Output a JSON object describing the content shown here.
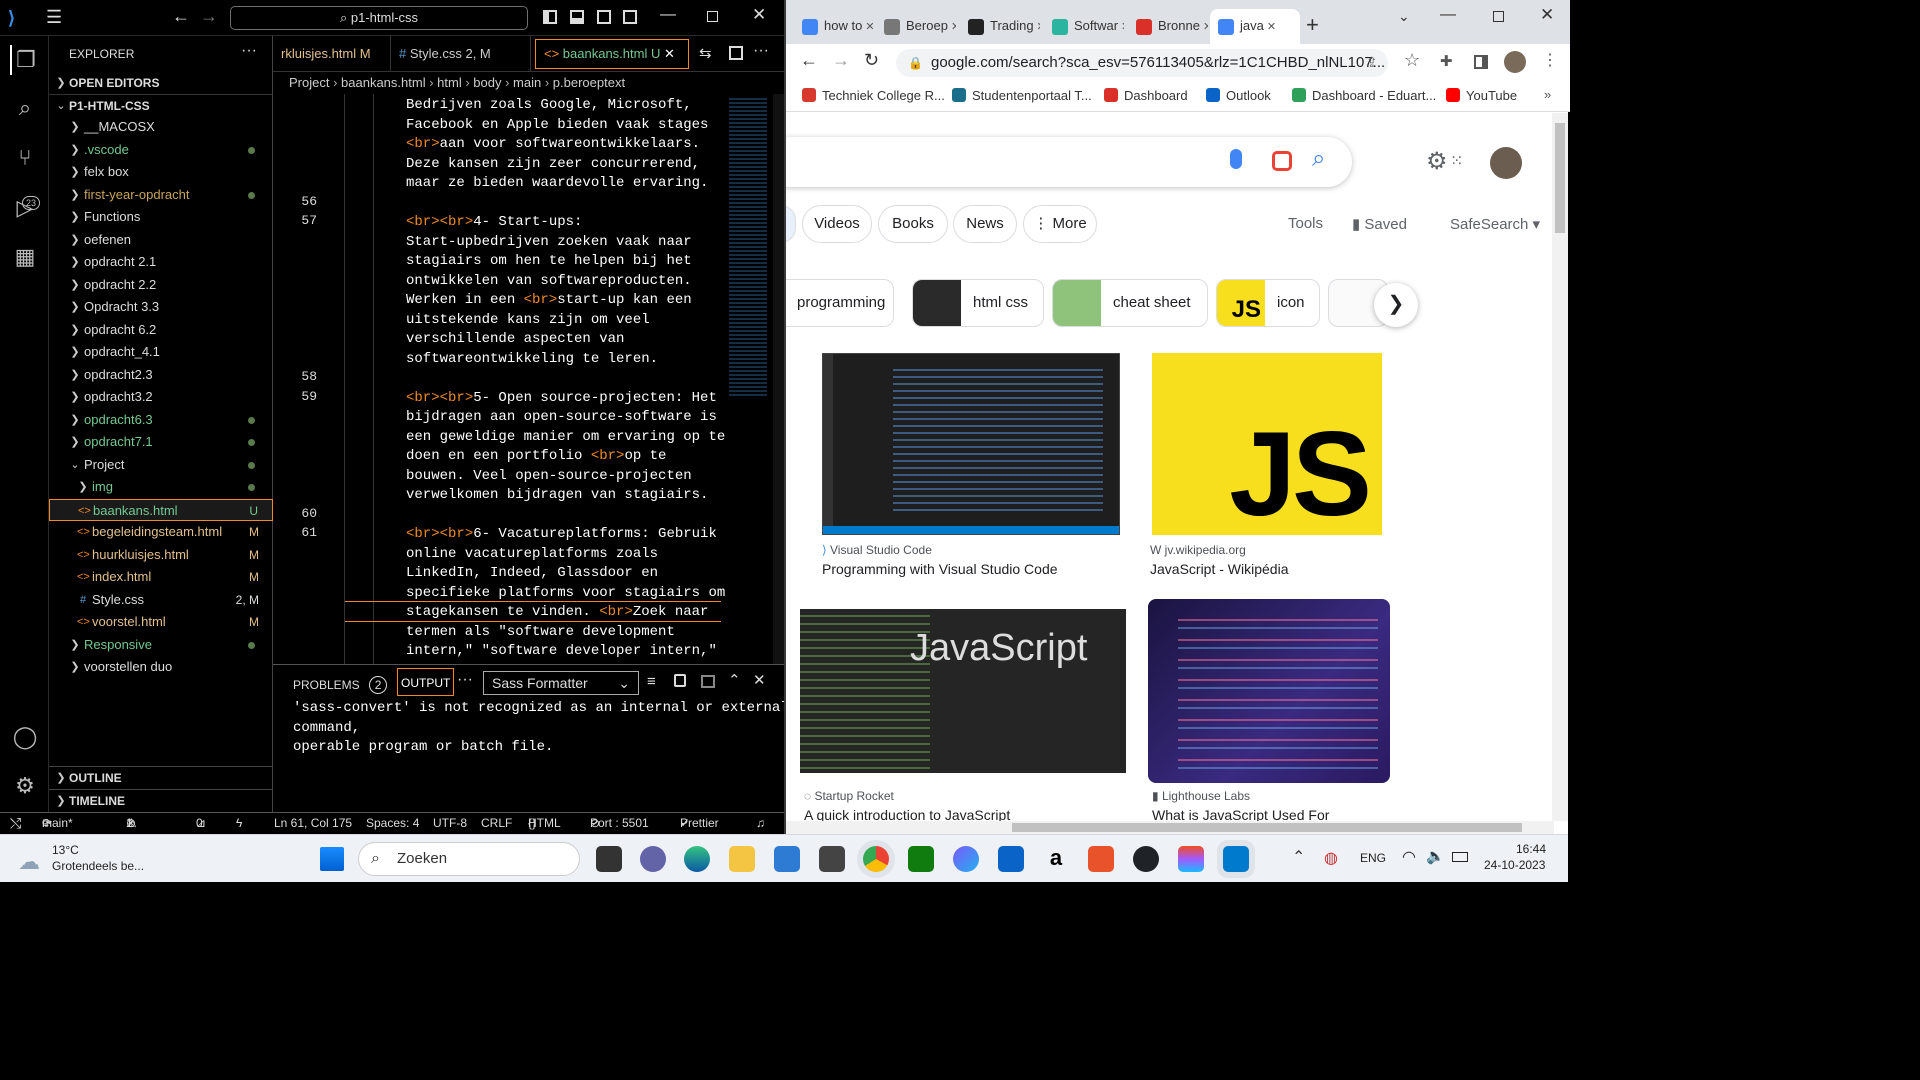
{
  "vscode": {
    "search": "p1-html-css",
    "explorer": {
      "title": "EXPLORER",
      "open_editors": "OPEN EDITORS",
      "root": "P1-HTML-CSS",
      "items": [
        {
          "label": "__MACOSX",
          "status": ""
        },
        {
          "label": ".vscode",
          "status": "dot"
        },
        {
          "label": "felx box",
          "status": ""
        },
        {
          "label": "first-year-opdracht",
          "status": "dot"
        },
        {
          "label": "Functions",
          "status": ""
        },
        {
          "label": "oefenen",
          "status": ""
        },
        {
          "label": "opdracht 2.1",
          "status": ""
        },
        {
          "label": "opdracht 2.2",
          "status": ""
        },
        {
          "label": "Opdracht 3.3",
          "status": ""
        },
        {
          "label": "opdracht 6.2",
          "status": ""
        },
        {
          "label": "opdracht_4.1",
          "status": ""
        },
        {
          "label": "opdracht2.3",
          "status": ""
        },
        {
          "label": "opdracht3.2",
          "status": ""
        },
        {
          "label": "opdracht6.3",
          "status": "dot"
        },
        {
          "label": "opdracht7.1",
          "status": "dot"
        },
        {
          "label": "Project",
          "status": "dot"
        },
        {
          "label": "img",
          "status": "dot"
        },
        {
          "label": "baankans.html",
          "status": "U"
        },
        {
          "label": "begeleidingsteam.html",
          "status": "M"
        },
        {
          "label": "huurkluisjes.html",
          "status": "M"
        },
        {
          "label": "index.html",
          "status": "M"
        },
        {
          "label": "Style.css",
          "status": "2, M"
        },
        {
          "label": "voorstel.html",
          "status": "M"
        },
        {
          "label": "Responsive",
          "status": "dot"
        },
        {
          "label": "voorstellen duo",
          "status": ""
        }
      ],
      "outline": "OUTLINE",
      "timeline": "TIMELINE"
    },
    "tabs": [
      {
        "label": "rkluisjes.html M"
      },
      {
        "label": "Style.css 2, M"
      },
      {
        "label": "baankans.html U"
      }
    ],
    "breadcrumbs": [
      "Project",
      "baankans.html",
      "html",
      "body",
      "main",
      "p.beroeptext"
    ],
    "code_lines": [
      {
        "num": "",
        "text": "Bedrijven zoals Google, Microsoft,"
      },
      {
        "num": "",
        "text": "Facebook en Apple bieden vaak stages"
      },
      {
        "num": "",
        "text": "<br>aan voor softwareontwikkelaars."
      },
      {
        "num": "",
        "text": "Deze kansen zijn zeer concurrerend,"
      },
      {
        "num": "",
        "text": "maar ze bieden waardevolle ervaring."
      },
      {
        "num": "56",
        "text": ""
      },
      {
        "num": "57",
        "text": "<br><br>4- Start-ups:"
      },
      {
        "num": "",
        "text": "Start-upbedrijven zoeken vaak naar"
      },
      {
        "num": "",
        "text": "stagiairs om hen te helpen bij het"
      },
      {
        "num": "",
        "text": "ontwikkelen van softwareproducten."
      },
      {
        "num": "",
        "text": "Werken in een <br>start-up kan een"
      },
      {
        "num": "",
        "text": "uitstekende kans zijn om veel"
      },
      {
        "num": "",
        "text": "verschillende aspecten van"
      },
      {
        "num": "",
        "text": "softwareontwikkeling te leren."
      },
      {
        "num": "58",
        "text": ""
      },
      {
        "num": "59",
        "text": "<br><br>5- Open source-projecten: Het"
      },
      {
        "num": "",
        "text": "bijdragen aan open-source-software is"
      },
      {
        "num": "",
        "text": "een geweldige manier om ervaring op te"
      },
      {
        "num": "",
        "text": "doen en een portfolio <br>op te"
      },
      {
        "num": "",
        "text": "bouwen. Veel open-source-projecten"
      },
      {
        "num": "",
        "text": "verwelkomen bijdragen van stagiairs."
      },
      {
        "num": "60",
        "text": ""
      },
      {
        "num": "61",
        "text": "<br><br>6- Vacatureplatforms: Gebruik"
      },
      {
        "num": "",
        "text": "online vacatureplatforms zoals"
      },
      {
        "num": "",
        "text": "LinkedIn, Indeed, Glassdoor en"
      },
      {
        "num": "",
        "text": "specifieke platforms voor stagiairs om"
      },
      {
        "num": "",
        "text": "stagekansen te vinden. <br>Zoek naar"
      },
      {
        "num": "",
        "text": "termen als \"software development"
      },
      {
        "num": "",
        "text": "intern,\" \"software developer intern,\""
      }
    ],
    "panel": {
      "problems": "PROBLEMS",
      "problems_count": "2",
      "output": "OUTPUT",
      "dropdown": "Sass Formatter",
      "output_text": "'sass-convert' is not recognized as an internal or external\ncommand,\noperable program or batch file."
    },
    "status": {
      "branch": "main*",
      "errors": "1",
      "warnings": "1",
      "ports": "0",
      "position": "Ln 61, Col 175",
      "spaces": "Spaces: 4",
      "encoding": "UTF-8",
      "eol": "CRLF",
      "language": "HTML",
      "port": "Port : 5501",
      "prettier": "Prettier"
    },
    "colors": {
      "modified": "#e2c08d",
      "untracked": "#73c991",
      "accent": "#f08a24"
    }
  },
  "chrome": {
    "tabs": [
      {
        "label": "how to",
        "color": "#4285f4"
      },
      {
        "label": "Beroep",
        "color": "#777777"
      },
      {
        "label": "Trading",
        "color": "#222222"
      },
      {
        "label": "Softwar",
        "color": "#2bb5a0"
      },
      {
        "label": "Bronne",
        "color": "#d9302a"
      },
      {
        "label": "java",
        "color": "#4285f4"
      }
    ],
    "url": "google.com/search?sca_esv=576113405&rlz=1C1CHBD_nlNL107...",
    "bookmarks": [
      {
        "label": "Techniek College R...",
        "color": "#d63a2e"
      },
      {
        "label": "Studentenportaal T...",
        "color": "#1b6e8a"
      },
      {
        "label": "Dashboard",
        "color": "#d9302a"
      },
      {
        "label": "Outlook",
        "color": "#0a64c8"
      },
      {
        "label": "Dashboard - Eduart...",
        "color": "#2fa05a"
      },
      {
        "label": "YouTube",
        "color": "#ff0000"
      }
    ],
    "search_tabs": [
      "Videos",
      "Books",
      "News",
      "More"
    ],
    "tools": "Tools",
    "saved": "Saved",
    "safesearch": "SafeSearch",
    "image_chips": [
      "programming",
      "html css",
      "cheat sheet",
      "icon"
    ],
    "results": [
      {
        "source": "Visual Studio Code",
        "title": "Programming with Visual Studio Code"
      },
      {
        "source": "jv.wikipedia.org",
        "title": "JavaScript - Wikipédia"
      },
      {
        "source": "Startup Rocket",
        "title": "A quick introduction to JavaScript"
      },
      {
        "source": "Lighthouse Labs",
        "title": "What is JavaScript Used For"
      }
    ],
    "js_logo_text": "JS",
    "javascript_banner": "JavaScript"
  },
  "taskbar": {
    "weather_temp": "13°C",
    "weather_desc": "Grotendeels be...",
    "search": "Zoeken",
    "language": "ENG",
    "time": "16:44",
    "date": "24-10-2023"
  }
}
